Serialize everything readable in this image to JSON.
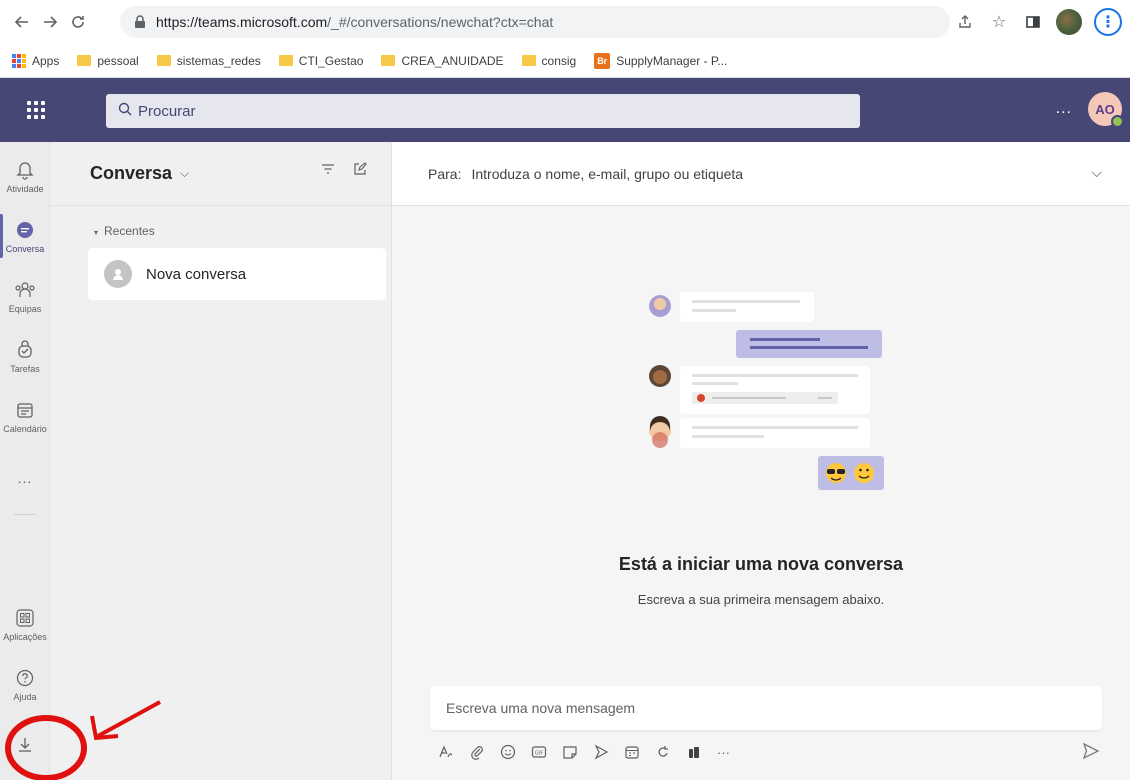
{
  "browser": {
    "url_scheme_host": "https://teams.microsoft.com",
    "url_path": "/_#/conversations/newchat?ctx=chat",
    "bookmarks": [
      {
        "label": "Apps",
        "type": "apps"
      },
      {
        "label": "pessoal",
        "type": "folder"
      },
      {
        "label": "sistemas_redes",
        "type": "folder"
      },
      {
        "label": "CTI_Gestao",
        "type": "folder"
      },
      {
        "label": "CREA_ANUIDADE",
        "type": "folder"
      },
      {
        "label": "consig",
        "type": "folder"
      },
      {
        "label": "SupplyManager - P...",
        "type": "site",
        "badge": "Br"
      }
    ]
  },
  "header": {
    "search_placeholder": "Procurar",
    "more": "...",
    "avatar_initials": "AO"
  },
  "rail": {
    "items": [
      {
        "label": "Atividade",
        "icon": "bell-icon"
      },
      {
        "label": "Conversa",
        "icon": "chat-icon",
        "active": true
      },
      {
        "label": "Equipas",
        "icon": "teams-icon"
      },
      {
        "label": "Tarefas",
        "icon": "tasks-icon"
      },
      {
        "label": "Calendário",
        "icon": "calendar-icon"
      }
    ],
    "more": "...",
    "apps_label": "Aplicações",
    "help_label": "Ajuda"
  },
  "chat_list": {
    "title": "Conversa",
    "recent_label": "Recentes",
    "items": [
      {
        "name": "Nova conversa"
      }
    ]
  },
  "main": {
    "to_label": "Para:",
    "to_placeholder": "Introduza o nome, e-mail, grupo ou etiqueta",
    "start_title": "Está a iniciar uma nova conversa",
    "start_subtitle": "Escreva a sua primeira mensagem abaixo.",
    "compose_placeholder": "Escreva uma nova mensagem",
    "toolbar_more": "···"
  },
  "colors": {
    "teams_purple": "#464775",
    "accent": "#6264a7",
    "annotation_red": "#e01010"
  }
}
